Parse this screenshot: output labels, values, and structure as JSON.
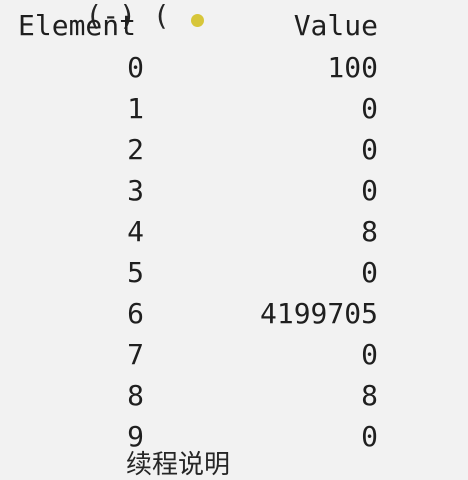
{
  "console": {
    "top_line": "(-) ( ",
    "header": {
      "element": "Element",
      "value": "Value"
    },
    "rows": [
      {
        "element": "0",
        "value": "100"
      },
      {
        "element": "1",
        "value": "0"
      },
      {
        "element": "2",
        "value": "0"
      },
      {
        "element": "3",
        "value": "0"
      },
      {
        "element": "4",
        "value": "8"
      },
      {
        "element": "5",
        "value": "0"
      },
      {
        "element": "6",
        "value": "4199705"
      },
      {
        "element": "7",
        "value": "0"
      },
      {
        "element": "8",
        "value": "8"
      },
      {
        "element": "9",
        "value": "0"
      }
    ],
    "bottom_line": "续程说明"
  }
}
